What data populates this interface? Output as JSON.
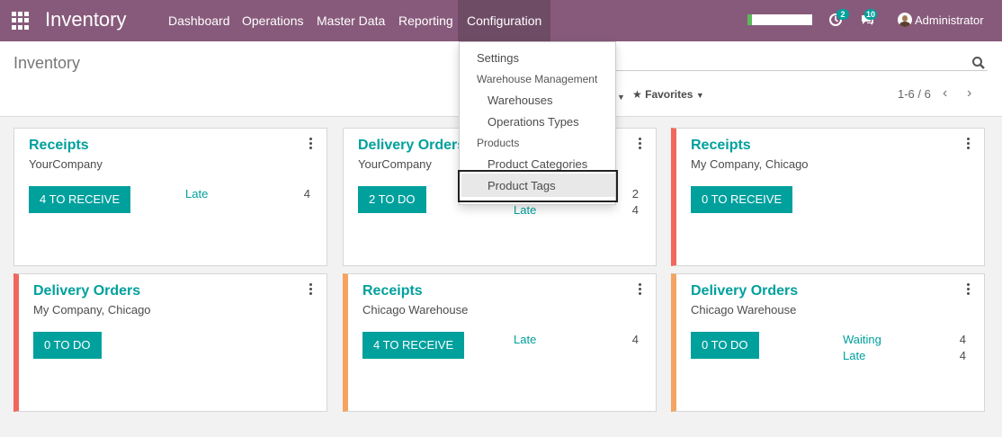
{
  "app": {
    "title": "Inventory"
  },
  "navbar": {
    "menu": [
      "Dashboard",
      "Operations",
      "Master Data",
      "Reporting",
      "Configuration"
    ],
    "activity_count": "2",
    "messages_count": "10",
    "user": "Administrator"
  },
  "control_panel": {
    "title": "Inventory",
    "favorites_label": "Favorites",
    "pager": "1-6 / 6"
  },
  "dropdown": {
    "settings": "Settings",
    "warehouse_management_header": "Warehouse Management",
    "warehouses": "Warehouses",
    "operations_types": "Operations Types",
    "products_header": "Products",
    "product_categories": "Product Categories",
    "product_tags": "Product Tags"
  },
  "cards": [
    {
      "title": "Receipts",
      "company": "YourCompany",
      "button": "4 TO RECEIVE",
      "stats": [
        {
          "label": "Late",
          "value": "4"
        }
      ]
    },
    {
      "title": "Delivery Orders",
      "company": "YourCompany",
      "button": "2 TO DO",
      "stats": [
        {
          "label": "",
          "value": "2"
        },
        {
          "label": "Late",
          "value": "4"
        }
      ]
    },
    {
      "title": "Receipts",
      "company": "My Company, Chicago",
      "button": "0 TO RECEIVE",
      "stats": []
    },
    {
      "title": "Delivery Orders",
      "company": "My Company, Chicago",
      "button": "0 TO DO",
      "stats": []
    },
    {
      "title": "Receipts",
      "company": "Chicago Warehouse",
      "button": "4 TO RECEIVE",
      "stats": [
        {
          "label": "Late",
          "value": "4"
        }
      ]
    },
    {
      "title": "Delivery Orders",
      "company": "Chicago Warehouse",
      "button": "0 TO DO",
      "stats": [
        {
          "label": "Waiting",
          "value": "4"
        },
        {
          "label": "Late",
          "value": "4"
        }
      ]
    }
  ],
  "colors": {
    "navbar": "#875a7b",
    "accent": "#00a09d",
    "red_bar": "#f0675c",
    "orange_bar": "#f4a460"
  },
  "icons": [
    "apps-grid-icon",
    "clock-icon",
    "chat-icon",
    "search-icon",
    "star-icon",
    "kebab-icon",
    "chevron-left-icon",
    "chevron-right-icon"
  ]
}
